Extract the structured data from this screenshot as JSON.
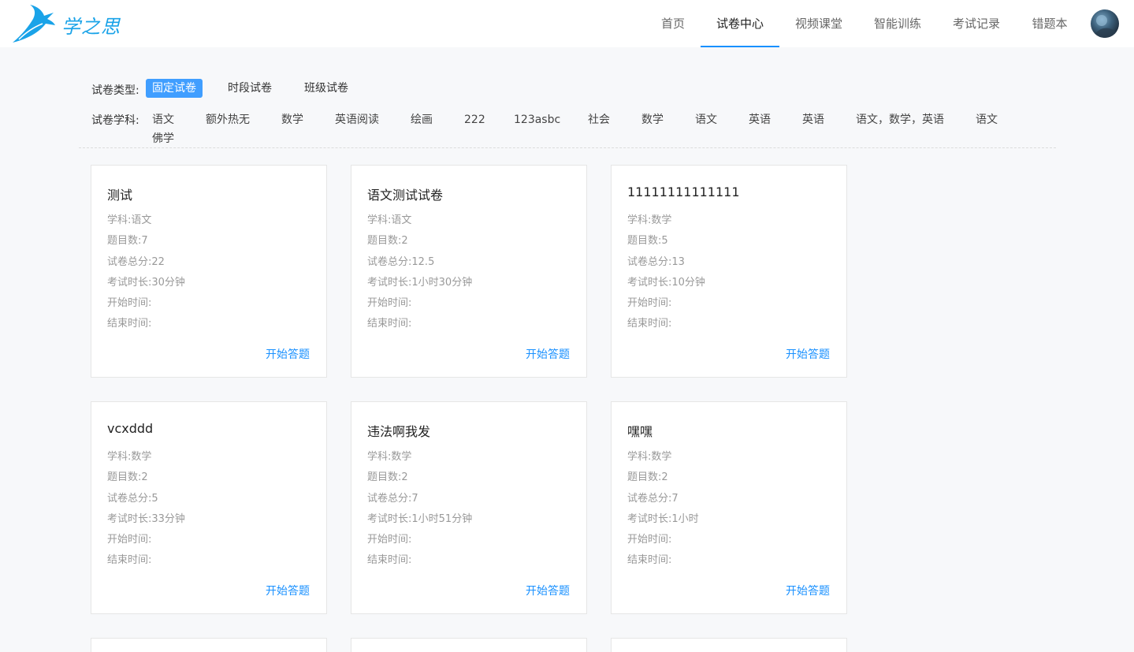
{
  "brand": {
    "name": "学之思"
  },
  "nav": [
    {
      "label": "首页",
      "active": false
    },
    {
      "label": "试卷中心",
      "active": true
    },
    {
      "label": "视频课堂",
      "active": false
    },
    {
      "label": "智能训练",
      "active": false
    },
    {
      "label": "考试记录",
      "active": false
    },
    {
      "label": "错题本",
      "active": false
    }
  ],
  "filters": {
    "type_label": "试卷类型:",
    "types": [
      {
        "label": "固定试卷",
        "active": true
      },
      {
        "label": "时段试卷",
        "active": false
      },
      {
        "label": "班级试卷",
        "active": false
      }
    ],
    "subject_label": "试卷学科:",
    "subjects": [
      "语文",
      "额外热无",
      "数学",
      "英语阅读",
      "绘画",
      "222",
      "123asbc",
      "社会",
      "数学",
      "语文",
      "英语",
      "英语",
      "语文，数学，英语",
      "语文",
      "佛学"
    ]
  },
  "field_labels": {
    "subject": "学科:",
    "count": "题目数:",
    "score": "试卷总分:",
    "duration": "考试时长:",
    "start": "开始时间:",
    "end": "结束时间:",
    "button": "开始答题"
  },
  "papers": [
    {
      "title": "测试",
      "subject": "语文",
      "count": "7",
      "score": "22",
      "duration": "30分钟",
      "start": "",
      "end": ""
    },
    {
      "title": "语文测试试卷",
      "subject": "语文",
      "count": "2",
      "score": "12.5",
      "duration": "1小时30分钟",
      "start": "",
      "end": ""
    },
    {
      "title": "11111111111111",
      "subject": "数学",
      "count": "5",
      "score": "13",
      "duration": "10分钟",
      "start": "",
      "end": ""
    },
    {
      "title": "vcxddd",
      "subject": "数学",
      "count": "2",
      "score": "5",
      "duration": "33分钟",
      "start": "",
      "end": ""
    },
    {
      "title": "违法啊我发",
      "subject": "数学",
      "count": "2",
      "score": "7",
      "duration": "1小时51分钟",
      "start": "",
      "end": ""
    },
    {
      "title": "嘿嘿",
      "subject": "数学",
      "count": "2",
      "score": "7",
      "duration": "1小时",
      "start": "",
      "end": ""
    }
  ]
}
